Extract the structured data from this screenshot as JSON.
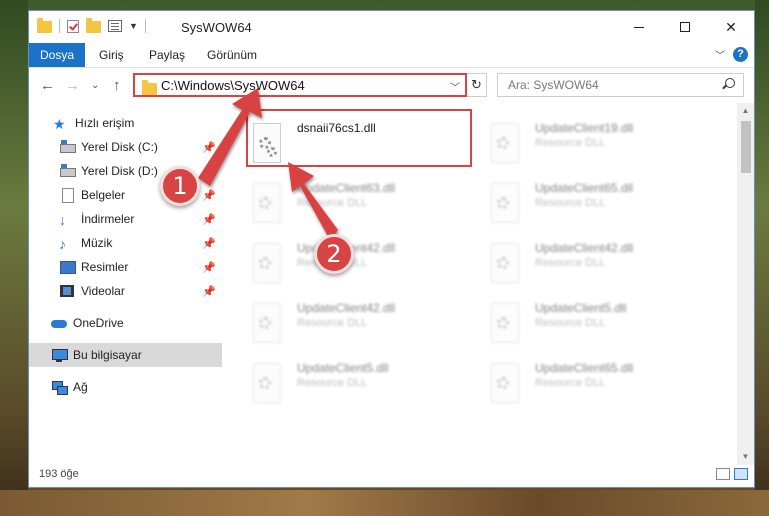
{
  "window": {
    "title": "SysWOW64",
    "minimize_glyph": "—",
    "maximize_glyph": "☐",
    "close_glyph": "✕"
  },
  "ribbon": {
    "tabs": [
      {
        "label": "Dosya"
      },
      {
        "label": "Giriş"
      },
      {
        "label": "Paylaş"
      },
      {
        "label": "Görünüm"
      }
    ],
    "help_label": "?"
  },
  "nav": {
    "back_glyph": "←",
    "forward_glyph": "→",
    "recent_glyph": "⌄",
    "up_glyph": "↑",
    "address_path": "C:\\Windows\\SysWOW64",
    "refresh_glyph": "↻",
    "search_placeholder": "Ara: SysWOW64"
  },
  "sidebar": {
    "items": [
      {
        "label": "Hızlı erişim",
        "icon": "star-icon"
      },
      {
        "label": "Yerel Disk (C:)",
        "icon": "drive-icon"
      },
      {
        "label": "Yerel Disk (D:)",
        "icon": "drive-icon"
      },
      {
        "label": "Belgeler",
        "icon": "documents-icon"
      },
      {
        "label": "İndirmeler",
        "icon": "downloads-icon"
      },
      {
        "label": "Müzik",
        "icon": "music-icon"
      },
      {
        "label": "Resimler",
        "icon": "pictures-icon"
      },
      {
        "label": "Videolar",
        "icon": "videos-icon"
      },
      {
        "label": "OneDrive",
        "icon": "cloud-icon"
      },
      {
        "label": "Bu bilgisayar",
        "icon": "computer-icon"
      },
      {
        "label": "Ağ",
        "icon": "network-icon"
      }
    ],
    "pin_glyph": "📌"
  },
  "files": [
    {
      "name": "dsnaii76cs1.dll",
      "type": ""
    },
    {
      "name": "UpdateClient19.dll",
      "type": "Resource DLL"
    },
    {
      "name": "UpdateClient63.dll",
      "type": "Resource DLL"
    },
    {
      "name": "UpdateClient65.dll",
      "type": "Resource DLL"
    },
    {
      "name": "UpdateClient42.dll",
      "type": "Resource DLL"
    },
    {
      "name": "UpdateClient42.dll",
      "type": "Resource DLL"
    },
    {
      "name": "UpdateClient42.dll",
      "type": "Resource DLL"
    },
    {
      "name": "UpdateClient5.dll",
      "type": "Resource DLL"
    },
    {
      "name": "UpdateClient5.dll",
      "type": "Resource DLL"
    },
    {
      "name": "UpdateClient65.dll",
      "type": "Resource DLL"
    }
  ],
  "status": {
    "item_count": "193 öğe"
  },
  "annotations": {
    "step1": "1",
    "step2": "2",
    "color": "#d84343"
  }
}
